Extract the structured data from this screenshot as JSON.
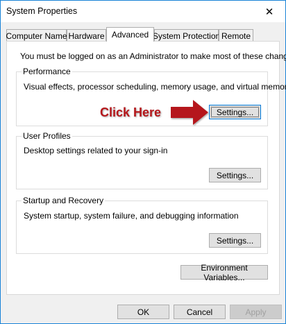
{
  "window": {
    "title": "System Properties",
    "close_glyph": "✕",
    "close_icon": "close-icon"
  },
  "tabs": [
    {
      "label": "Computer Name",
      "active": false
    },
    {
      "label": "Hardware",
      "active": false
    },
    {
      "label": "Advanced",
      "active": true
    },
    {
      "label": "System Protection",
      "active": false
    },
    {
      "label": "Remote",
      "active": false
    }
  ],
  "advanced": {
    "admin_note": "You must be logged on as an Administrator to make most of these changes.",
    "performance": {
      "label": "Performance",
      "description": "Visual effects, processor scheduling, memory usage, and virtual memory",
      "button": "Settings..."
    },
    "user_profiles": {
      "label": "User Profiles",
      "description": "Desktop settings related to your sign-in",
      "button": "Settings..."
    },
    "startup_recovery": {
      "label": "Startup and Recovery",
      "description": "System startup, system failure, and debugging information",
      "button": "Settings..."
    },
    "env_button": "Environment Variables..."
  },
  "annotation": {
    "text": "Click Here",
    "color": "#b5171b",
    "arrow_icon": "arrow-right-icon"
  },
  "footer": {
    "ok": "OK",
    "cancel": "Cancel",
    "apply": "Apply"
  },
  "colors": {
    "accent": "#0078d7",
    "window_border": "#1883d7"
  }
}
